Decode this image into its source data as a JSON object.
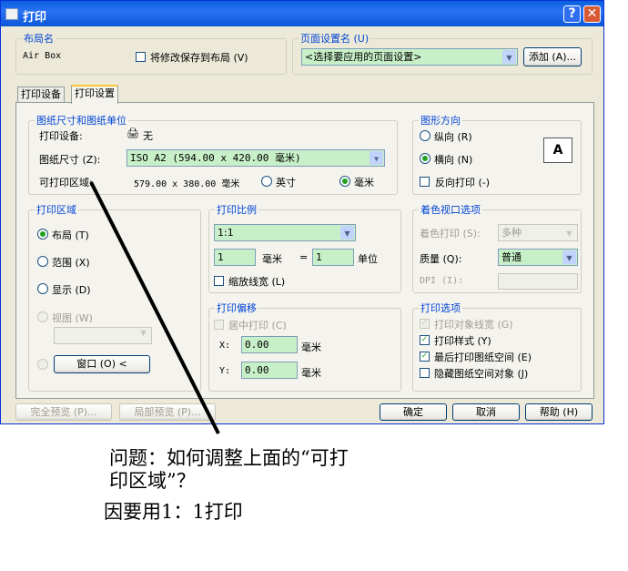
{
  "window": {
    "title": "打印"
  },
  "layout_group": {
    "legend": "布局名",
    "layout_name": "Air Box",
    "save_changes_label": "将修改保存到布局 (V)"
  },
  "page_setup_group": {
    "legend": "页面设置名 (U)",
    "selected": "<选择要应用的页面设置>",
    "add_button": "添加 (A)..."
  },
  "tabs": [
    {
      "label": "打印设备",
      "active": false
    },
    {
      "label": "打印设置",
      "active": true
    }
  ],
  "paper_group": {
    "legend": "图纸尺寸和图纸单位",
    "device_label": "打印设备:",
    "device_value": "无",
    "size_label": "图纸尺寸 (Z):",
    "size_value": "ISO A2 (594.00 x 420.00 毫米)",
    "area_label": "可打印区域:",
    "area_value": "579.00 x 380.00 毫米",
    "unit_inch": "英寸",
    "unit_mm": "毫米",
    "selected_unit": "毫米"
  },
  "orientation_group": {
    "legend": "图形方向",
    "portrait": "纵向 (R)",
    "landscape": "横向 (N)",
    "selected": "横向 (N)",
    "reverse": "反向打印 (-)",
    "preview_letter": "A"
  },
  "print_area_group": {
    "legend": "打印区域",
    "layout": "布局 (T)",
    "extents": "范围 (X)",
    "display": "显示 (D)",
    "view": "视图 (W)",
    "window_button": "窗口 (O) <",
    "selected": "布局 (T)"
  },
  "scale_group": {
    "legend": "打印比例",
    "scale_value": "1:1",
    "value_left": "1",
    "unit_mm": "毫米",
    "equals": "=",
    "value_right": "1",
    "unit_label": "单位",
    "scale_lineweights": "缩放线宽 (L)"
  },
  "offset_group": {
    "legend": "打印偏移",
    "center_label": "居中打印 (C)",
    "x_label": "X:",
    "x_value": "0.00",
    "y_label": "Y:",
    "y_value": "0.00",
    "unit": "毫米"
  },
  "shaded_group": {
    "legend": "着色视口选项",
    "shade_label": "着色打印 (S):",
    "shade_value": "多种",
    "quality_label": "质量 (Q):",
    "quality_value": "普通",
    "dpi_label": "DPI (I):"
  },
  "options_group": {
    "legend": "打印选项",
    "items": [
      {
        "label": "打印对象线宽 (G)",
        "checked": true,
        "enabled": false
      },
      {
        "label": "打印样式 (Y)",
        "checked": true,
        "enabled": true
      },
      {
        "label": "最后打印图纸空间 (E)",
        "checked": true,
        "enabled": true
      },
      {
        "label": "隐藏图纸空间对象 (J)",
        "checked": false,
        "enabled": true
      }
    ]
  },
  "bottom_buttons": {
    "full_preview": "完全预览 (P)...",
    "partial_preview": "局部预览 (P)...",
    "ok": "确定",
    "cancel": "取消",
    "help": "帮助 (H)"
  },
  "caption": {
    "line1": "问题：如何调整上面的“可打",
    "line2": "印区域”？",
    "line3": "因要用1：1打印"
  },
  "colors": {
    "title_bar": "#0a5fdc",
    "dialog_bg": "#ece9d8",
    "legend_text": "#0046d5",
    "field_fill": "#c8f0c8"
  }
}
